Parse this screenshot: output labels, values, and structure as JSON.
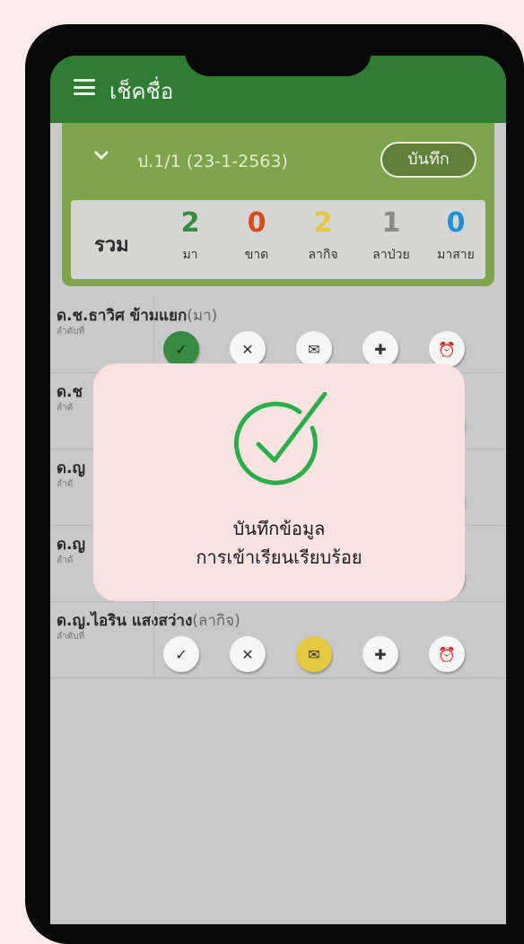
{
  "app": {
    "title": "เช็คชื่อ"
  },
  "class_card": {
    "label": "ป.1/1 (23-1-2563)",
    "save_label": "บันทึก",
    "summary": {
      "total_label": "รวม",
      "stats": [
        {
          "count": "2",
          "label": "มา",
          "color": "#3a8b42"
        },
        {
          "count": "0",
          "label": "ขาด",
          "color": "#d84a1c"
        },
        {
          "count": "2",
          "label": "ลากิจ",
          "color": "#e4c940"
        },
        {
          "count": "1",
          "label": "ลาป่วย",
          "color": "#8a8a8a"
        },
        {
          "count": "0",
          "label": "มาสาย",
          "color": "#1f8fd6"
        }
      ]
    }
  },
  "students": [
    {
      "name": "ด.ช.ธาวิศ ข้ามแยก",
      "status": "(มา)",
      "order_label": "ลำดับที่",
      "selected": "present"
    },
    {
      "name": "ด.ช",
      "status": "",
      "order_label": "ลำดั",
      "selected": ""
    },
    {
      "name": "ด.ญ",
      "status": "",
      "order_label": "ลำดั",
      "selected": ""
    },
    {
      "name": "ด.ญ",
      "status": "",
      "order_label": "ลำดั",
      "selected": ""
    },
    {
      "name": "ด.ญ.ไอริน แสงสว่าง",
      "status": "(ลากิจ)",
      "order_label": "ลำดับที่",
      "selected": "leave"
    }
  ],
  "action_icons": [
    "check-icon",
    "close-icon",
    "mail-icon",
    "medical-plus-icon",
    "alarm-clock-icon"
  ],
  "toast": {
    "line1": "บันทึกข้อมูล",
    "line2": "การเข้าเรียนเรียบร้อย",
    "icon": "check-circle-icon",
    "accent": "#2aad4a"
  }
}
